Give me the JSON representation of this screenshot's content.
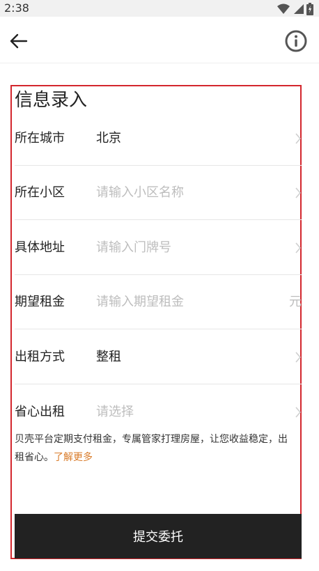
{
  "status_bar": {
    "time": "2:38"
  },
  "form": {
    "title": "信息录入",
    "fields": [
      {
        "label": "所在城市",
        "value": "北京"
      },
      {
        "label": "所在小区",
        "placeholder": "请输入小区名称"
      },
      {
        "label": "具体地址",
        "placeholder": "请输入门牌号"
      },
      {
        "label": "期望租金",
        "placeholder": "请输入期望租金",
        "unit": "元"
      },
      {
        "label": "出租方式",
        "value": "整租"
      },
      {
        "label": "省心出租",
        "placeholder": "请选择"
      }
    ],
    "description": "贝壳平台定期支付租金，专属管家打理房屋，让您收益稳定，出租省心。",
    "learn_more": "了解更多",
    "submit_label": "提交委托"
  },
  "colors": {
    "frame": "#d3262d",
    "link": "#d97b29",
    "button": "#222222"
  },
  "icons": [
    "back-arrow-icon",
    "info-icon",
    "wifi-icon",
    "signal-icon",
    "battery-icon",
    "chevron-right-icon"
  ]
}
